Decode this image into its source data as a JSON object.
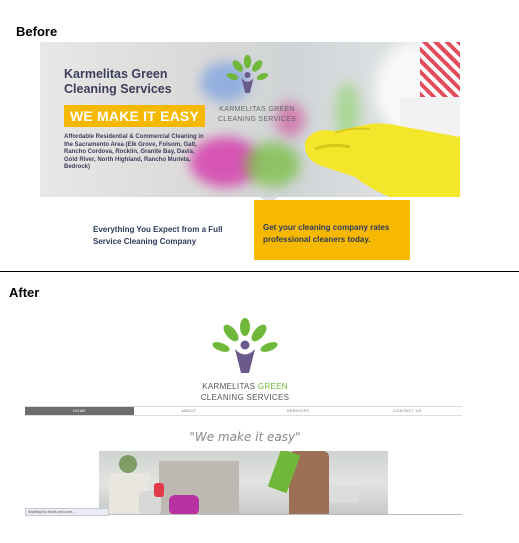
{
  "labels": {
    "before": "Before",
    "after": "After"
  },
  "before": {
    "hero_title_line1": "Karmelitas Green",
    "hero_title_line2": "Cleaning Services",
    "banner": "WE MAKE IT EASY",
    "service_area": "Affordable Residential & Commercial Cleaning in the Sacramento Area (Elk Grove, Folsom, Galt, Rancho Cordova, Rocklin, Granite Bay, Davis, Gold River, North Highland, Rancho Murieta, Bedrock)",
    "logo_line1": "KARMELITAS GREEN",
    "logo_line2": "CLEANING SERVICES",
    "left_tagline_line1": "Everything You Expect from a Full",
    "left_tagline_line2": "Service Cleaning Company",
    "right_tagline_line1": "Get your cleaning company rates",
    "right_tagline_line2": "professional cleaners today."
  },
  "after": {
    "brand_part1": "KARMELITAS ",
    "brand_part2": "GREEN",
    "brand_line2": "CLEANING SERVICES",
    "nav": [
      "HOME",
      "ABOUT",
      "SERVICES",
      "CONTACT US"
    ],
    "tagline": "\"We make it easy\"",
    "status": "Waiting for fonts.net.com..."
  },
  "colors": {
    "accent": "#f6b900",
    "brand_green": "#6fb83a",
    "logo_purple": "#6a5a8c",
    "nav_active": "#6c6c6c"
  },
  "icons": [
    "tree-logo-icon"
  ]
}
